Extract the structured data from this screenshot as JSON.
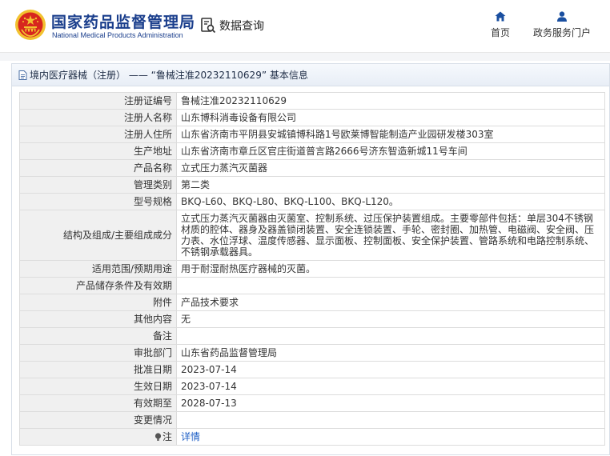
{
  "header": {
    "brand_cn": "国家药品监督管理局",
    "brand_en": "National Medical Products Administration",
    "data_query": "数据查询",
    "nav": [
      {
        "label": "首页",
        "icon": "home-icon"
      },
      {
        "label": "政务服务门户",
        "icon": "user-icon"
      }
    ]
  },
  "panel": {
    "title": "境内医疗器械（注册） —— “鲁械注准20232110629” 基本信息"
  },
  "rows": [
    {
      "label": "注册证编号",
      "value": "鲁械注准20232110629"
    },
    {
      "label": "注册人名称",
      "value": "山东博科消毒设备有限公司"
    },
    {
      "label": "注册人住所",
      "value": "山东省济南市平阴县安城镇博科路1号欧莱博智能制造产业园研发楼303室"
    },
    {
      "label": "生产地址",
      "value": "山东省济南市章丘区官庄街道普言路2666号济东智造新城11号车间"
    },
    {
      "label": "产品名称",
      "value": "立式压力蒸汽灭菌器"
    },
    {
      "label": "管理类别",
      "value": "第二类"
    },
    {
      "label": "型号规格",
      "value": "BKQ-L60、BKQ-L80、BKQ-L100、BKQ-L120。"
    },
    {
      "label": "结构及组成/主要组成成分",
      "value": "立式压力蒸汽灭菌器由灭菌室、控制系统、过压保护装置组成。主要零部件包括：单层304不锈钢材质的腔体、器身及器盖锁闭装置、安全连锁装置、手轮、密封圈、加热管、电磁阀、安全阀、压力表、水位浮球、温度传感器、显示面板、控制面板、安全保护装置、管路系统和电路控制系统、不锈钢承载器具。"
    },
    {
      "label": "适用范围/预期用途",
      "value": "用于耐湿耐热医疗器械的灭菌。"
    },
    {
      "label": "产品储存条件及有效期",
      "value": ""
    },
    {
      "label": "附件",
      "value": "产品技术要求"
    },
    {
      "label": "其他内容",
      "value": "无"
    },
    {
      "label": "备注",
      "value": ""
    },
    {
      "label": "审批部门",
      "value": "山东省药品监督管理局"
    },
    {
      "label": "批准日期",
      "value": "2023-07-14"
    },
    {
      "label": "生效日期",
      "value": "2023-07-14"
    },
    {
      "label": "有效期至",
      "value": "2028-07-13"
    },
    {
      "label": "变更情况",
      "value": ""
    },
    {
      "label": "注",
      "value": "详情"
    }
  ],
  "colors": {
    "brand_blue": "#1a3e8c",
    "link_blue": "#1e5fc6",
    "emblem_red": "#d7261e",
    "emblem_gold": "#f2c230"
  }
}
